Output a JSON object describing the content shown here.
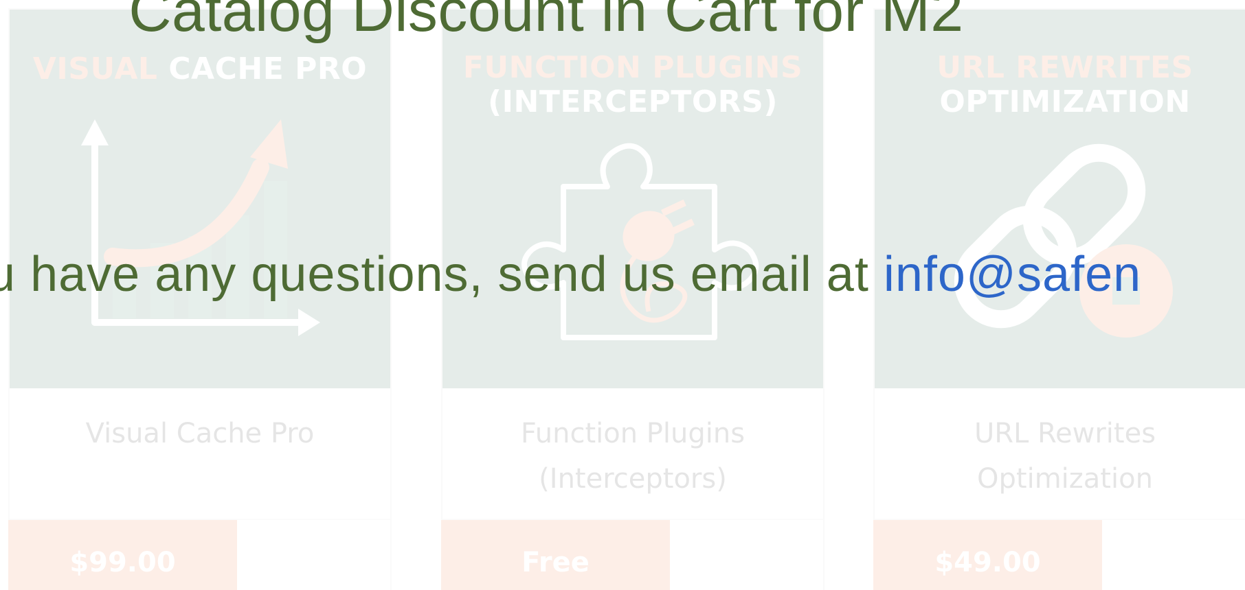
{
  "page": {
    "title": "Catalog Discount in Cart for M2",
    "contact": {
      "text": "you have any questions, send us email at",
      "email": "info@safen"
    }
  },
  "colors": {
    "title_text": "#4e6b34",
    "link_text": "#2d66c9",
    "card_image_bg": "#1a5e44",
    "accent_orange": "#f26a2c"
  },
  "products": [
    {
      "image_title_accent": "VISUAL",
      "image_title_rest": "CACHE PRO",
      "image_title_line2": "",
      "name_line1": "Visual Cache Pro",
      "name_line2": "",
      "price": "$99.00",
      "icon": "growth-chart-icon"
    },
    {
      "image_title_accent": "FUNCTION PLUGINS",
      "image_title_rest": "",
      "image_title_line2": "(INTERCEPTORS)",
      "name_line1": "Function Plugins",
      "name_line2": "(Interceptors)",
      "price": "Free",
      "icon": "puzzle-plug-icon"
    },
    {
      "image_title_accent": "URL REWRITES",
      "image_title_rest": "",
      "image_title_line2": "OPTIMIZATION",
      "name_line1": "URL Rewrites",
      "name_line2": "Optimization",
      "price": "$49.00",
      "icon": "chain-link-icon"
    }
  ]
}
